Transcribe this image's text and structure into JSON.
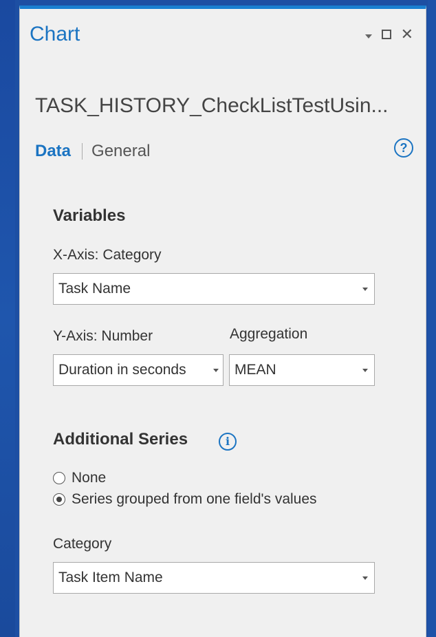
{
  "panel": {
    "title": "Chart",
    "layer_name": "TASK_HISTORY_CheckListTestUsin..."
  },
  "tabs": {
    "data": "Data",
    "general": "General"
  },
  "help_glyph": "?",
  "variables": {
    "heading": "Variables",
    "x_axis_label": "X-Axis: Category",
    "x_axis_value": "Task Name",
    "y_axis_label": "Y-Axis: Number",
    "y_axis_value": "Duration in seconds",
    "aggregation_label": "Aggregation",
    "aggregation_value": "MEAN"
  },
  "additional_series": {
    "heading": "Additional Series",
    "info_glyph": "i",
    "option_none": "None",
    "option_grouped": "Series grouped from one field's values",
    "selected": "Series grouped from one field's values",
    "category_label": "Category",
    "category_value": "Task Item Name"
  },
  "colors": {
    "accent": "#1b74c2",
    "background": "#1d4fa3",
    "panel": "#f0f0f0"
  },
  "icons": [
    "pin-dropdown-icon",
    "maximize-icon",
    "close-icon",
    "help-icon",
    "info-icon",
    "chevron-down-icon"
  ]
}
